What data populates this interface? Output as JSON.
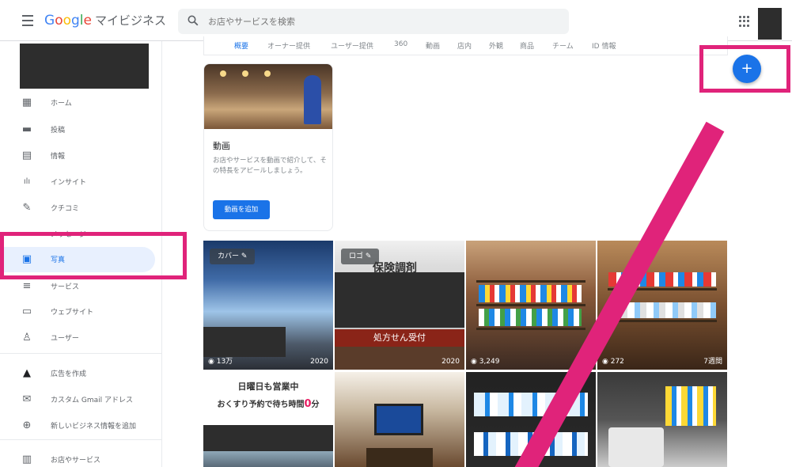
{
  "header": {
    "menu_icon": "menu-icon",
    "brand_google": [
      "G",
      "o",
      "o",
      "g",
      "l",
      "e"
    ],
    "brand_suffix": "マイビジネス",
    "search_placeholder": "お店やサービスを検索",
    "apps_icon": "apps-grid-icon"
  },
  "sidebar": {
    "items": [
      {
        "label": "ホーム",
        "icon": "▦"
      },
      {
        "label": "投稿",
        "icon": "▬"
      },
      {
        "label": "情報",
        "icon": "▤"
      },
      {
        "label": "インサイト",
        "icon": "ılı"
      },
      {
        "label": "クチコミ",
        "icon": "✎"
      },
      {
        "label": "メッセージ",
        "icon": "▭"
      },
      {
        "label": "写真",
        "icon": "▣"
      },
      {
        "label": "サービス",
        "icon": "≡"
      },
      {
        "label": "ウェブサイト",
        "icon": "▭"
      },
      {
        "label": "ユーザー",
        "icon": "♙"
      },
      {
        "label": "広告を作成",
        "icon": "▲"
      },
      {
        "label": "カスタム Gmail アドレス",
        "icon": "✉"
      },
      {
        "label": "新しいビジネス情報を追加",
        "icon": "⊕"
      },
      {
        "label": "お店やサービス",
        "icon": "▥"
      }
    ]
  },
  "tabs": [
    "概要",
    "オーナー提供",
    "ユーザー提供",
    "360",
    "動画",
    "店内",
    "外観",
    "商品",
    "チーム",
    "ID 情報"
  ],
  "video_card": {
    "title": "動画",
    "description": "お店やサービスを動画で紹介して、その特長をアピールしましょう。",
    "button": "動画を追加"
  },
  "photos": {
    "row1": [
      {
        "chip": "カバー",
        "count": "13万",
        "year": "2020"
      },
      {
        "chip": "ロゴ",
        "title": "保険調剤",
        "sign": "処方せん受付",
        "year": "2020"
      },
      {
        "count": "3,249"
      },
      {
        "count": "272",
        "extra": "7週間"
      }
    ],
    "banner": {
      "line1": "日曜日も営業中",
      "line2_a": "おくすり予約で待ち時間",
      "line2_b": "0",
      "line2_c": "分"
    }
  },
  "fab": {
    "label": "+"
  },
  "colors": {
    "accent": "#1a73e8",
    "highlight": "#e0237a"
  }
}
